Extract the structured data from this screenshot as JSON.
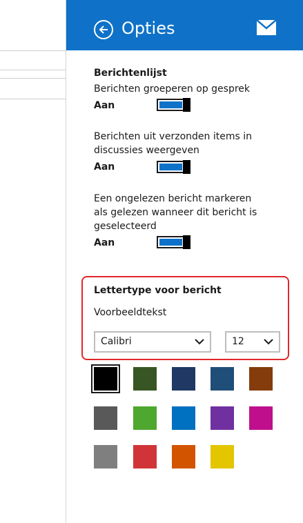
{
  "header": {
    "title": "Opties",
    "color": "#0f72c8"
  },
  "section": {
    "heading": "Berichtenlijst"
  },
  "settings": [
    {
      "text": "Berichten groeperen op gesprek",
      "state": "Aan",
      "on": true
    },
    {
      "text": "Berichten uit verzonden items in discussies weergeven",
      "state": "Aan",
      "on": true
    },
    {
      "text": "Een ongelezen bericht markeren als gelezen wanneer dit bericht is geselecteerd",
      "state": "Aan",
      "on": true
    }
  ],
  "font": {
    "heading": "Lettertype voor bericht",
    "sample": "Voorbeeldtekst",
    "family": "Calibri",
    "size": "12"
  },
  "swatches": [
    "#000000",
    "#375623",
    "#1f3864",
    "#1f4e79",
    "#843c0c",
    "#595959",
    "#4ea72e",
    "#0070c0",
    "#7030a0",
    "#c00f8c",
    "#7f7f7f",
    "#d13438",
    "#d35400",
    "#e3c500"
  ],
  "selected_swatch": 0
}
